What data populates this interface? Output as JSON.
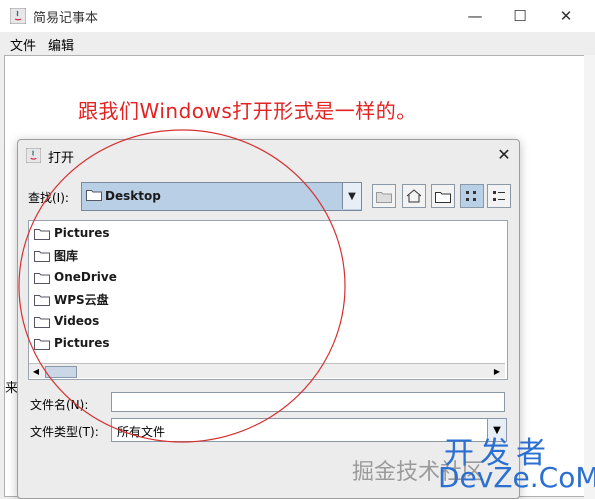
{
  "app": {
    "title": "简易记事本",
    "menu": [
      "文件",
      "编辑"
    ],
    "note_text": "跟我们Windows打开形式是一样的。",
    "status_fragment": "来"
  },
  "window_controls": {
    "minimize": "—",
    "maximize": "☐",
    "close": "✕"
  },
  "dialog": {
    "title": "打开",
    "close": "✕",
    "look_in_label": "查找(I):",
    "look_in_value": "Desktop",
    "files": [
      "Pictures",
      "图库",
      "OneDrive",
      "WPS云盘",
      "Videos",
      "Pictures"
    ],
    "file_name_label": "文件名(N):",
    "file_name_value": "",
    "file_type_label": "文件类型(T):",
    "file_type_value": "所有文件"
  },
  "watermark": {
    "line1": "掘金技术社区",
    "brand_top": "开发者",
    "brand_bottom": "DevZe.CoM"
  },
  "colors": {
    "annotation_red": "#e32222",
    "combo_blue": "#b8cfe5",
    "brand_blue": "#2a6fd1"
  }
}
